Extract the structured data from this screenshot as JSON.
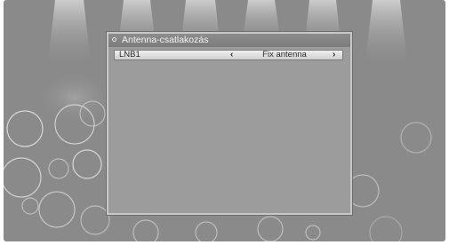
{
  "dialog": {
    "title": "Antenna-csatlakozás"
  },
  "settings": [
    {
      "label": "LNB1",
      "value": "Fix antenna",
      "prev_icon": "chevron-left-icon",
      "next_icon": "chevron-right-icon"
    }
  ],
  "icons": {
    "prev_glyph": "‹",
    "next_glyph": "›",
    "title_bullet": "circle-bullet-icon"
  },
  "colors": {
    "screen_background": "#8a8a8a",
    "dialog_background": "#9c9c9c",
    "title_bar": "#7b7b7b",
    "selected_row": "#e4e4e4"
  }
}
